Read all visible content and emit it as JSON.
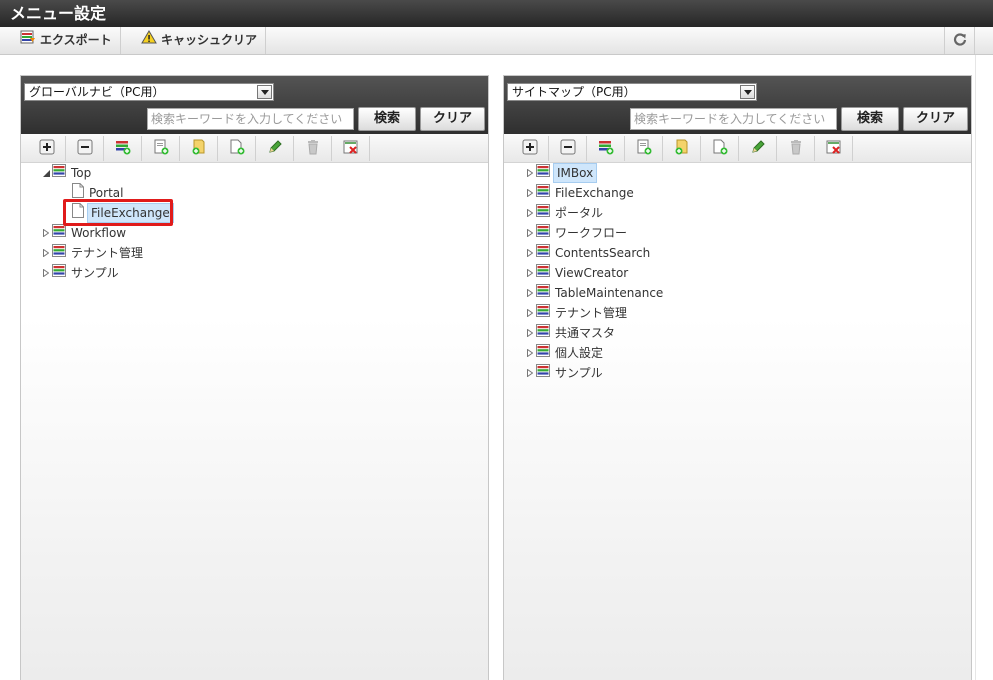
{
  "window": {
    "title": "メニュー設定"
  },
  "toolbar": {
    "export_label": "エクスポート",
    "cache_clear_label": "キャッシュクリア"
  },
  "left_panel": {
    "selected_menu": "グローバルナビ（PC用）",
    "search_placeholder": "検索キーワードを入力してください",
    "search_label": "検索",
    "clear_label": "クリア",
    "tree": [
      {
        "label": "Top",
        "expanded": true,
        "icon": "menu-group-icon",
        "children": [
          {
            "label": "Portal",
            "icon": "page-icon"
          },
          {
            "label": "FileExchange",
            "icon": "page-icon",
            "selected": true
          }
        ]
      },
      {
        "label": "Workflow",
        "icon": "menu-group-icon"
      },
      {
        "label": "テナント管理",
        "icon": "menu-group-icon"
      },
      {
        "label": "サンプル",
        "icon": "menu-group-icon"
      }
    ]
  },
  "right_panel": {
    "selected_menu": "サイトマップ（PC用）",
    "search_placeholder": "検索キーワードを入力してください",
    "search_label": "検索",
    "clear_label": "クリア",
    "tree": [
      {
        "label": "IMBox",
        "selected": true
      },
      {
        "label": "FileExchange"
      },
      {
        "label": "ポータル"
      },
      {
        "label": "ワークフロー"
      },
      {
        "label": "ContentsSearch"
      },
      {
        "label": "ViewCreator"
      },
      {
        "label": "TableMaintenance"
      },
      {
        "label": "テナント管理"
      },
      {
        "label": "共通マスタ"
      },
      {
        "label": "個人設定"
      },
      {
        "label": "サンプル"
      }
    ]
  },
  "tree_toolbar_icons": [
    "expand-all-icon",
    "collapse-all-icon",
    "add-menu-group-icon",
    "add-page-icon",
    "add-folder-icon",
    "add-item-icon",
    "edit-pencil-icon",
    "delete-trash-icon",
    "remove-icon"
  ],
  "colors": {
    "highlight": "#e01b1b",
    "selection": "#cfe6fb"
  }
}
